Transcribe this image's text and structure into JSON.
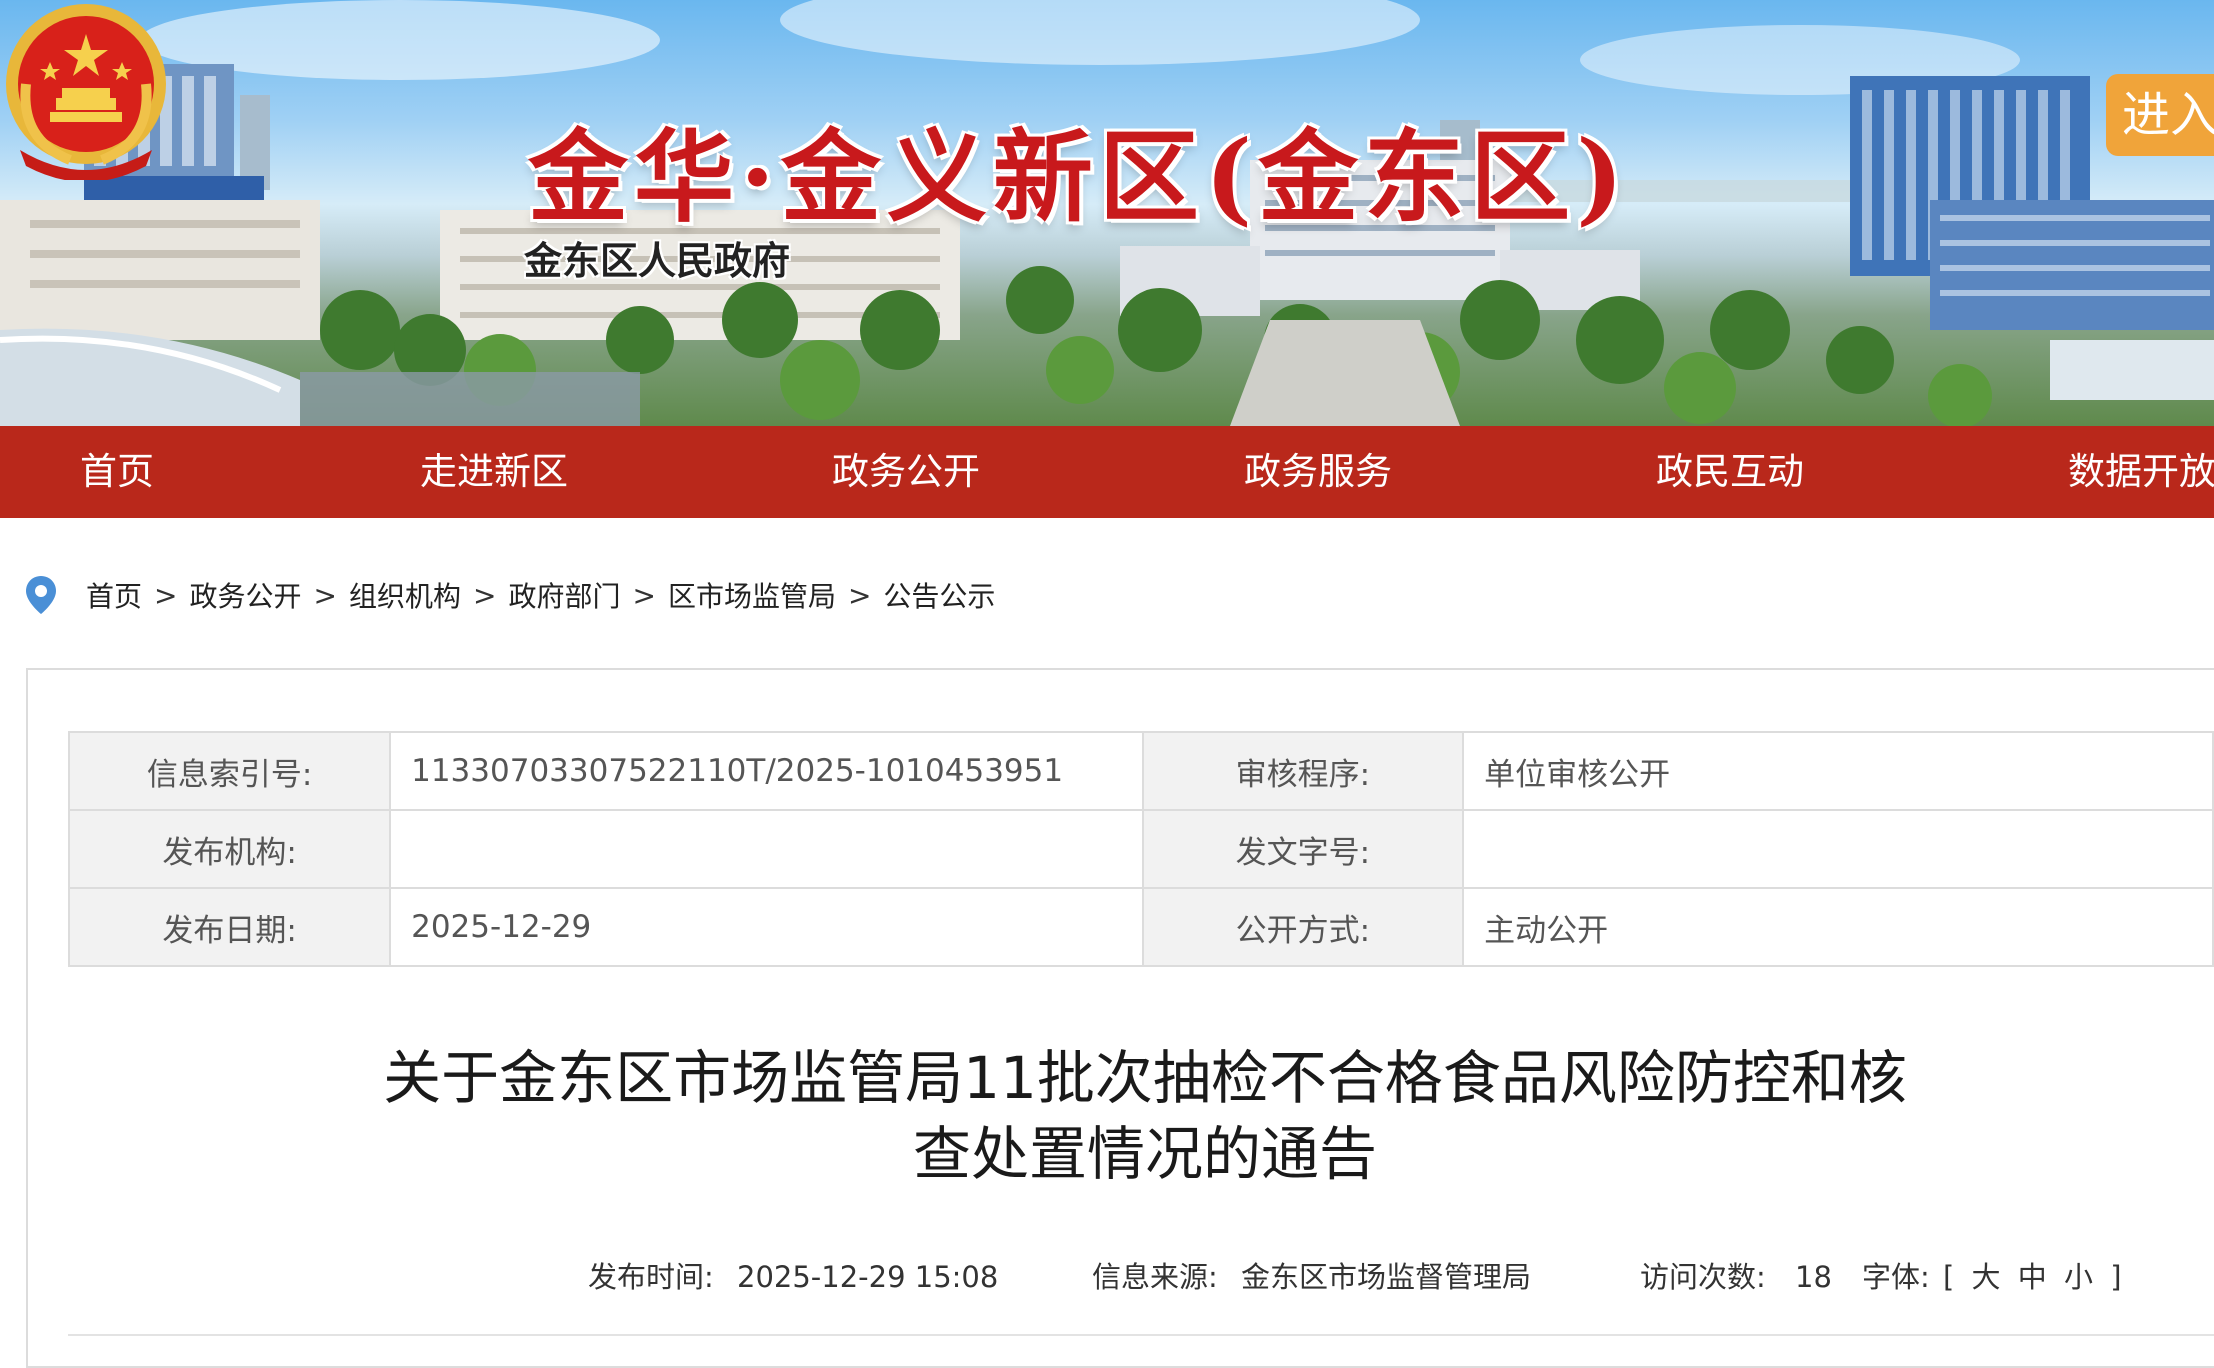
{
  "header": {
    "title": "金华·金义新区(金东区)",
    "subtitle": "金东区人民政府",
    "enter_label": "进入"
  },
  "nav": {
    "items": [
      {
        "label": "首页"
      },
      {
        "label": "走进新区"
      },
      {
        "label": "政务公开"
      },
      {
        "label": "政务服务"
      },
      {
        "label": "政民互动"
      },
      {
        "label": "数据开放"
      }
    ]
  },
  "breadcrumb": {
    "icon": "location-pin-icon",
    "items": [
      "首页",
      "政务公开",
      "组织机构",
      "政府部门",
      "区市场监管局",
      "公告公示"
    ],
    "separator": ">"
  },
  "meta": {
    "index_label": "信息索引号:",
    "index_value": "11330703307522110T/2025-1010453951",
    "review_label": "审核程序:",
    "review_value": "单位审核公开",
    "org_label": "发布机构:",
    "org_value": "",
    "doc_no_label": "发文字号:",
    "doc_no_value": "",
    "date_label": "发布日期:",
    "date_value": "2025-12-29",
    "public_label": "公开方式:",
    "public_value": "主动公开"
  },
  "article": {
    "title_line1": "关于金东区市场监管局11批次抽检不合格食品风险防控和核",
    "title_line2": "查处置情况的通告",
    "publish_time_label": "发布时间:",
    "publish_time_value": "2025-12-29 15:08",
    "source_label": "信息来源:",
    "source_value": "金东区市场监督管理局",
    "visits_label": "访问次数:",
    "visits_value": "18",
    "font_label": "字体:",
    "font_open": "[",
    "font_large": "大",
    "font_medium": "中",
    "font_small": "小",
    "font_close": "]"
  },
  "colors": {
    "nav_bg": "#b9281b",
    "title_red": "#c8191c",
    "enter_orange": "#f0a43a",
    "label_bg": "#f2f2f2",
    "pin_blue": "#4a8fd6"
  }
}
